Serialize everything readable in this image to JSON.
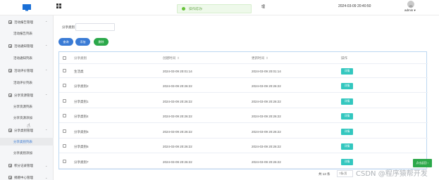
{
  "header": {
    "toast_message": "操作成功!",
    "system_title": "理",
    "datetime": "2024-03-09 20:40:50",
    "user": "admin ▾"
  },
  "sidebar": {
    "items": [
      {
        "label": "活动报告管理",
        "type": "group"
      },
      {
        "label": "活动报告列表",
        "type": "sub"
      },
      {
        "label": "活动通知管理",
        "type": "group"
      },
      {
        "label": "活动通知列表",
        "type": "sub"
      },
      {
        "label": "活动评价管理",
        "type": "group"
      },
      {
        "label": "活动评价列表",
        "type": "sub"
      },
      {
        "label": "分享资源管理",
        "type": "group"
      },
      {
        "label": "分享资源列表",
        "type": "sub"
      },
      {
        "label": "分享资源添加",
        "type": "sub"
      },
      {
        "label": "分享类别管理",
        "type": "group"
      },
      {
        "label": "分享类别列表",
        "type": "sub",
        "active": true
      },
      {
        "label": "分享类别添加",
        "type": "sub"
      },
      {
        "label": "积分记录管理",
        "type": "group"
      },
      {
        "label": "捐赠中心管理",
        "type": "group"
      }
    ]
  },
  "search": {
    "label": "分享类别",
    "value": ""
  },
  "toolbar": {
    "search_label": "查询",
    "add_label": "添加",
    "delete_label": "删除"
  },
  "table": {
    "headers": {
      "name": "分享类别",
      "created": "创建时间",
      "updated": "更新时间",
      "op": "操作"
    },
    "rows": [
      {
        "name": "生活类",
        "created": "2024-03-09 20:01:14",
        "updated": "2024-03-09 20:01:14",
        "op": "详情"
      },
      {
        "name": "分享类别2",
        "created": "2024-03-09 20:26:22",
        "updated": "2024-03-09 20:26:22",
        "op": "详情"
      },
      {
        "name": "分享类别1",
        "created": "2024-03-09 20:26:22",
        "updated": "2024-03-09 20:26:22",
        "op": "详情"
      },
      {
        "name": "分享类别4",
        "created": "2024-03-09 20:26:22",
        "updated": "2024-03-09 20:26:22",
        "op": "详情"
      },
      {
        "name": "分享类别5",
        "created": "2024-03-09 20:26:22",
        "updated": "2024-03-09 20:26:22",
        "op": "详情"
      },
      {
        "name": "分享类别6",
        "created": "2024-03-09 20:26:22",
        "updated": "2024-03-09 20:26:22",
        "op": "详情"
      },
      {
        "name": "分享类别7",
        "created": "2024-03-09 20:26:22",
        "updated": "2024-03-09 20:26:22",
        "op": "详情"
      }
    ]
  },
  "pagination": {
    "total": "共 13 条",
    "page_size": "7条/页"
  },
  "float_button": "点击返回 ↑",
  "watermark": "CSDN @程序猿帮开发",
  "colors": {
    "primary": "#3a7bd5",
    "success": "#2ba84a",
    "detail": "#33c7bf",
    "toast_bg": "#eef9ea"
  }
}
